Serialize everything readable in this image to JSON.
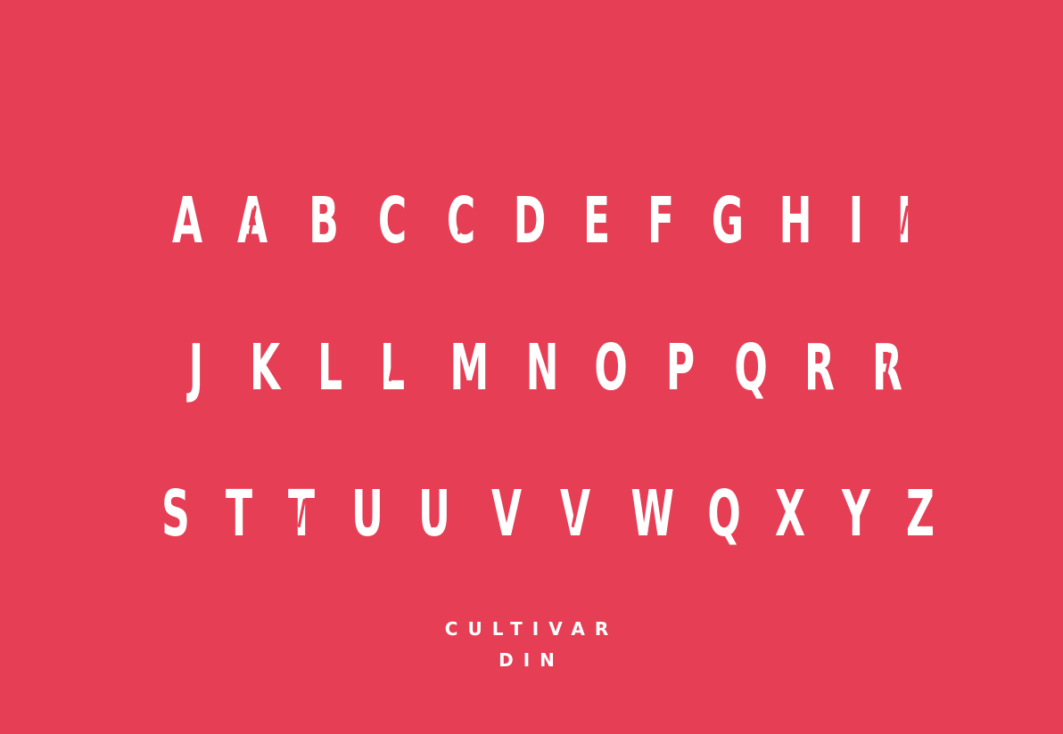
{
  "specimen": {
    "background": "#e63e54",
    "glyph_color": "#ffffff",
    "rows": [
      [
        "A",
        "A",
        "B",
        "C",
        "C",
        "D",
        "E",
        "F",
        "G",
        "H",
        "I",
        "I"
      ],
      [
        "J",
        "K",
        "L",
        "L",
        "M",
        "N",
        "O",
        "P",
        "Q",
        "R",
        "R"
      ],
      [
        "S",
        "T",
        "T",
        "U",
        "U",
        "V",
        "V",
        "W",
        "Q",
        "X",
        "Y",
        "Z"
      ]
    ],
    "alternate_glyphs": {
      "row_1": [
        1,
        4,
        11
      ],
      "row_2": [
        3,
        10
      ],
      "row_3": [
        2,
        4,
        6
      ]
    }
  },
  "caption": {
    "line_1": "CULTIVAR",
    "line_2": "DIN"
  }
}
